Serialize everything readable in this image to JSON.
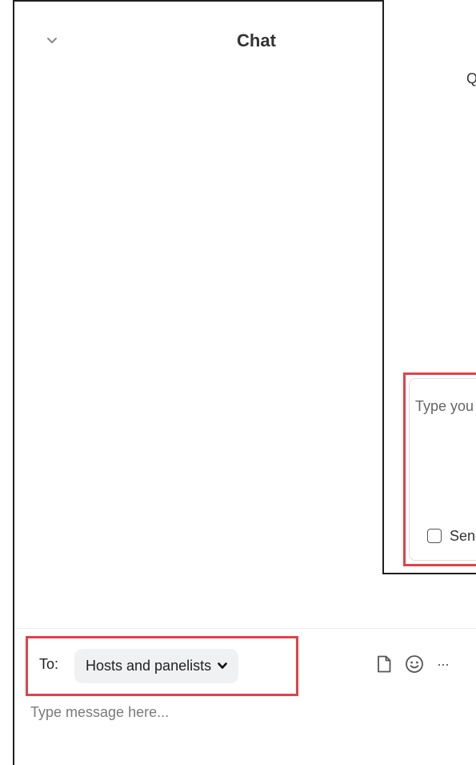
{
  "chat": {
    "title": "Chat",
    "to_label": "To:",
    "recipient": "Hosts and panelists",
    "message_placeholder": "Type message here...",
    "more_symbol": "···",
    "icons": {
      "collapse": "chevron-down-icon",
      "recipient_dropdown": "chevron-down-icon",
      "file": "file-icon",
      "emoji": "smiley-icon",
      "more": "more-icon"
    }
  },
  "qa_panel": {
    "label_partial": "Q",
    "input_text_partial": "Type you",
    "send_label_partial": "Send"
  },
  "colors": {
    "highlight_red": "#e0424a",
    "recipient_bg": "#f0f1f3",
    "border_dark": "#1f1f1f"
  }
}
